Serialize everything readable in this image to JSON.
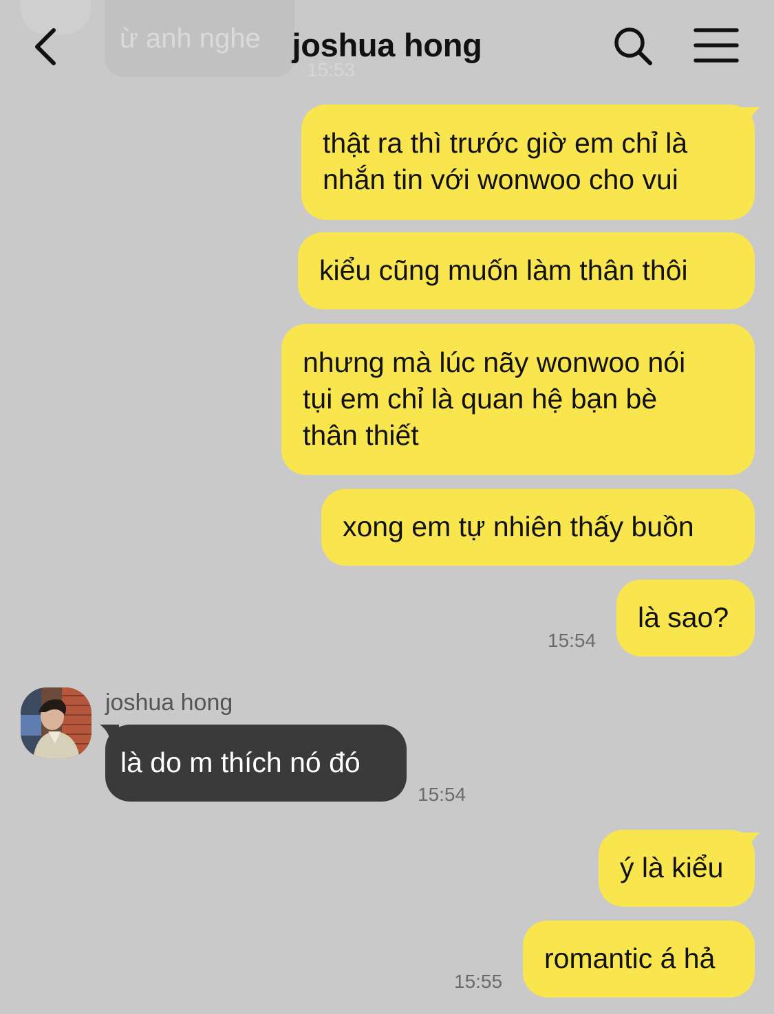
{
  "header": {
    "title": "joshua hong"
  },
  "previous": {
    "text": "ừ anh nghe",
    "time": "15:53"
  },
  "messages": [
    {
      "side": "out",
      "lines": [
        "thật ra thì trước giờ em chỉ là",
        "nhắn tin với wonwoo cho vui"
      ]
    },
    {
      "side": "out",
      "lines": [
        "kiểu cũng muốn làm thân thôi"
      ]
    },
    {
      "side": "out",
      "lines": [
        "nhưng mà lúc nãy wonwoo nói",
        "tụi em chỉ là quan hệ bạn bè",
        "thân thiết"
      ]
    },
    {
      "side": "out",
      "lines": [
        "xong em tự nhiên thấy buồn"
      ]
    },
    {
      "side": "out",
      "lines": [
        "là sao?"
      ],
      "time": "15:54"
    },
    {
      "side": "in",
      "sender": "joshua hong",
      "lines": [
        "là do m thích nó đó"
      ],
      "time": "15:54"
    },
    {
      "side": "out",
      "lines": [
        "ý là kiểu"
      ]
    },
    {
      "side": "out",
      "lines": [
        "romantic á hả"
      ],
      "time": "15:55"
    }
  ],
  "colors": {
    "outgoing": "#f9e54e",
    "incoming": "#3a3a3a",
    "background": "#c9c9c9"
  },
  "icons": {
    "back": "chevron-left-icon",
    "search": "search-icon",
    "menu": "hamburger-menu-icon"
  }
}
